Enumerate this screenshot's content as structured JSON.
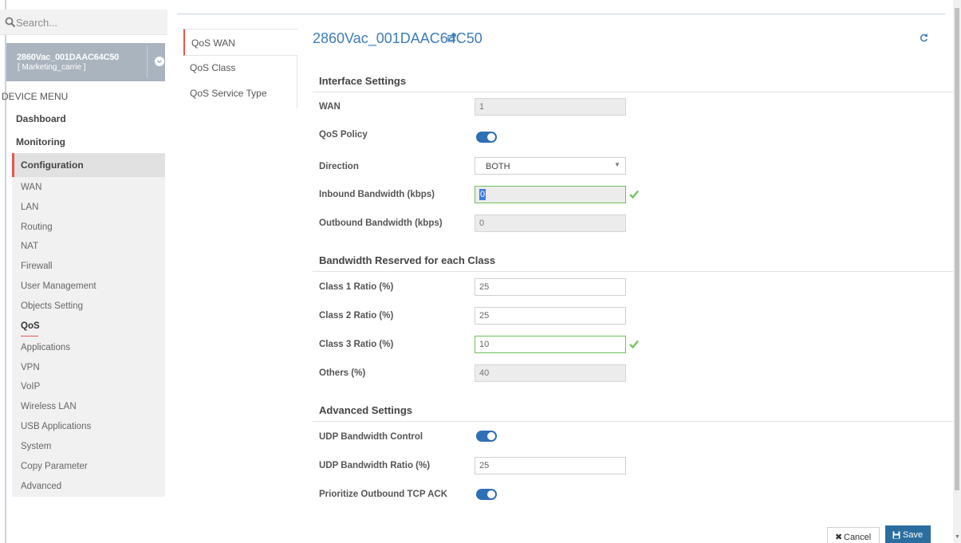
{
  "search": {
    "placeholder": "Search..."
  },
  "device": {
    "name": "2860Vac_001DAAC64C50",
    "group": "[ Marketing_carrie ]"
  },
  "menu": {
    "title": "DEVICE MENU",
    "top_items": [
      "Dashboard",
      "Monitoring",
      "Configuration"
    ],
    "sub_items": [
      "WAN",
      "LAN",
      "Routing",
      "NAT",
      "Firewall",
      "User Management",
      "Objects Setting",
      "QoS",
      "Applications",
      "VPN",
      "VoIP",
      "Wireless LAN",
      "USB Applications",
      "System",
      "Copy Parameter",
      "Advanced"
    ],
    "active_sub": "QoS"
  },
  "tabs": [
    "QoS WAN",
    "QoS Class",
    "QoS Service Type"
  ],
  "page": {
    "title": "2860Vac_001DAAC64C50"
  },
  "interface_settings": {
    "title": "Interface Settings",
    "wan_label": "WAN",
    "wan_value": "1",
    "qos_policy_label": "QoS Policy",
    "qos_policy_on": true,
    "direction_label": "Direction",
    "direction_value": "BOTH",
    "inbound_label": "Inbound Bandwidth (kbps)",
    "inbound_value": "0",
    "outbound_label": "Outbound Bandwidth (kbps)",
    "outbound_value": "0"
  },
  "bandwidth_reserved": {
    "title": "Bandwidth Reserved for each Class",
    "class1_label": "Class 1 Ratio (%)",
    "class1_value": "25",
    "class2_label": "Class 2 Ratio (%)",
    "class2_value": "25",
    "class3_label": "Class 3 Ratio (%)",
    "class3_value": "10",
    "others_label": "Others (%)",
    "others_value": "40"
  },
  "advanced_settings": {
    "title": "Advanced Settings",
    "udp_control_label": "UDP Bandwidth Control",
    "udp_control_on": true,
    "udp_ratio_label": "UDP Bandwidth Ratio (%)",
    "udp_ratio_value": "25",
    "tcp_ack_label": "Prioritize Outbound TCP ACK",
    "tcp_ack_on": true
  },
  "buttons": {
    "cancel": "Cancel",
    "save": "Save"
  },
  "colors": {
    "accent_red": "#e8564f",
    "title_blue": "#3e7db8",
    "toggle_blue": "#2f6fb5",
    "save_blue": "#2b6d9f",
    "valid_green": "#6fbf5a"
  }
}
